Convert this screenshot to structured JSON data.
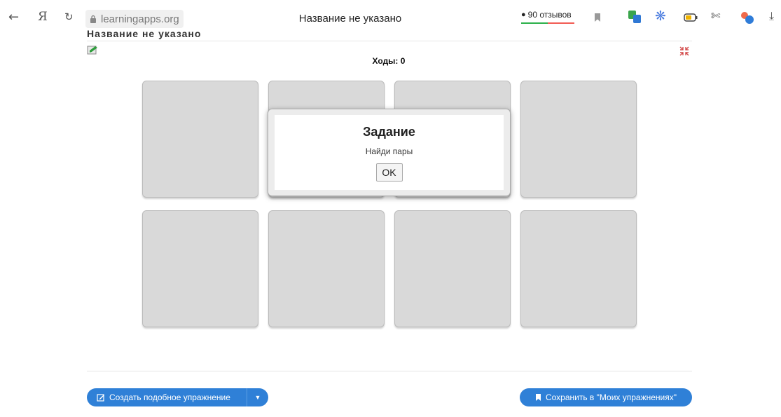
{
  "browser": {
    "back_icon": "arrow-left-icon",
    "logo_glyph": "Я",
    "reload_icon": "reload-icon",
    "lock_icon": "lock-icon",
    "url": "learningapps.org",
    "tab_title": "Название не указано",
    "reviews_label": "90 отзывов",
    "bookmark_icon": "bookmark-icon",
    "extension_icons": [
      "translate-icon",
      "snowflake-icon",
      "battery-icon",
      "scissors-icon"
    ],
    "download_icon": "download-icon"
  },
  "page": {
    "heading": "Название не указано",
    "moves_label": "Ходы: 0",
    "card_color": "#d9d9d9"
  },
  "modal": {
    "title": "Задание",
    "text": "Найди пары",
    "ok_label": "OK"
  },
  "footer": {
    "create_label": "Создать подобное упражнение",
    "save_label": "Сохранить в \"Моих упражнениях\"",
    "button_color": "#2f80d7"
  }
}
